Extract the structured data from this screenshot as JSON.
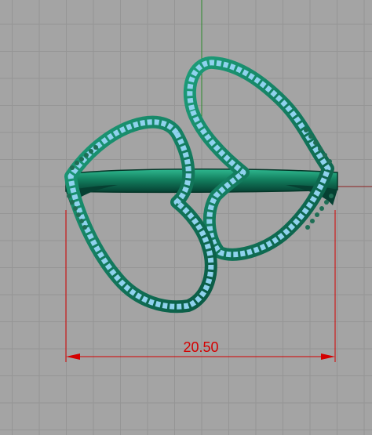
{
  "viewport": {
    "background": "#a4a4a4",
    "grid_color": "#959595",
    "axis_x_color": "#8a2020",
    "axis_y_color": "#2c8a2c"
  },
  "model": {
    "metal_color": "#14876a",
    "metal_dark": "#0a4a38",
    "stone_color": "#8fd2ee",
    "prong_color": "#1f6e55"
  },
  "dimension": {
    "value": "20.50",
    "color": "#d40000"
  }
}
